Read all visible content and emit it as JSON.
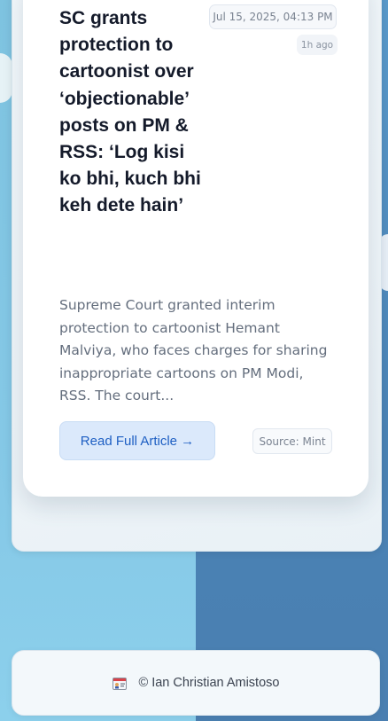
{
  "article": {
    "title": "SC grants protection to cartoonist over ‘objectionable’ posts on PM & RSS: ‘Log kisi ko bhi, kuch bhi keh dete hain’",
    "date": "Jul 15, 2025, 04:13 PM",
    "relative_time": "1h ago",
    "summary": "Supreme Court granted interim protection to cartoonist Hemant Malviya, who faces charges for sharing inappropriate cartoons on PM Modi, RSS. The court...",
    "read_label": "Read Full Article →",
    "source": "Source: Mint"
  },
  "footer": {
    "icon": "id-card-icon",
    "text": "© Ian Christian Amistoso"
  },
  "colors": {
    "accent": "#1e5fc3",
    "button_bg": "#dbe9fb",
    "title": "#141a2a"
  }
}
